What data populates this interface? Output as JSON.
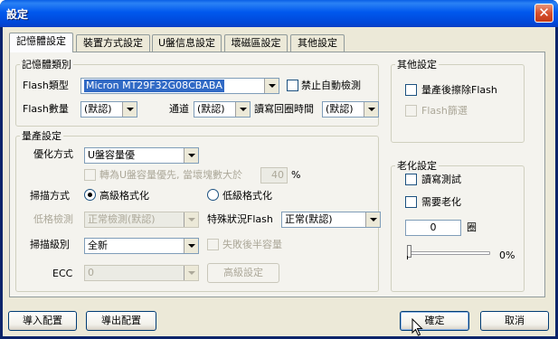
{
  "window": {
    "title": "設定",
    "close_symbol": "✕"
  },
  "tabs": [
    {
      "label": "記憶體設定",
      "active": true
    },
    {
      "label": "裝置方式設定",
      "active": false
    },
    {
      "label": "U盤信息設定",
      "active": false
    },
    {
      "label": "壞磁區設定",
      "active": false
    },
    {
      "label": "其他設定",
      "active": false
    }
  ],
  "memory_type": {
    "legend": "記憶體類別",
    "flash_type_label": "Flash類型",
    "flash_type_value": "Micron MT29F32G08CBABA",
    "disable_autodetect_label": "禁止自動檢測",
    "flash_count_label": "Flash數量",
    "flash_count_value": "(默認)",
    "channel_label": "通道",
    "channel_value": "(默認)",
    "rw_cycles_label": "讀寫回圈時間",
    "rw_cycles_value": "(默認)"
  },
  "production": {
    "legend": "量產設定",
    "optimize_label": "優化方式",
    "optimize_value": "U盤容量優",
    "switch_capacity_label": "轉為U盤容量優先, 當壞塊數大於",
    "switch_capacity_value": "40",
    "switch_capacity_unit": "%",
    "scan_mode_label": "掃描方式",
    "scan_high_label": "高級格式化",
    "scan_low_label": "低級格式化",
    "low_format_check_label": "低格檢測",
    "low_format_check_value": "正常檢測(默認)",
    "special_flash_label": "特殊狀況Flash",
    "special_flash_value": "正常(默認)",
    "scan_level_label": "掃描級別",
    "scan_level_value": "全新",
    "half_capacity_label": "失敗後半容量",
    "ecc_label": "ECC",
    "ecc_value": "0",
    "advanced_button": "高級設定"
  },
  "other": {
    "legend": "其他設定",
    "erase_after_label": "量產後擦除Flash",
    "flash_filter_label": "Flash篩選"
  },
  "aging": {
    "legend": "老化設定",
    "rw_test_label": "讀寫測試",
    "need_aging_label": "需要老化",
    "cycles_value": "0",
    "cycles_unit": "圈",
    "progress_text": "0%",
    "progress_fraction": 0
  },
  "footer": {
    "import_button": "導入配置",
    "export_button": "導出配置",
    "ok_button": "確定",
    "cancel_button": "取消"
  }
}
